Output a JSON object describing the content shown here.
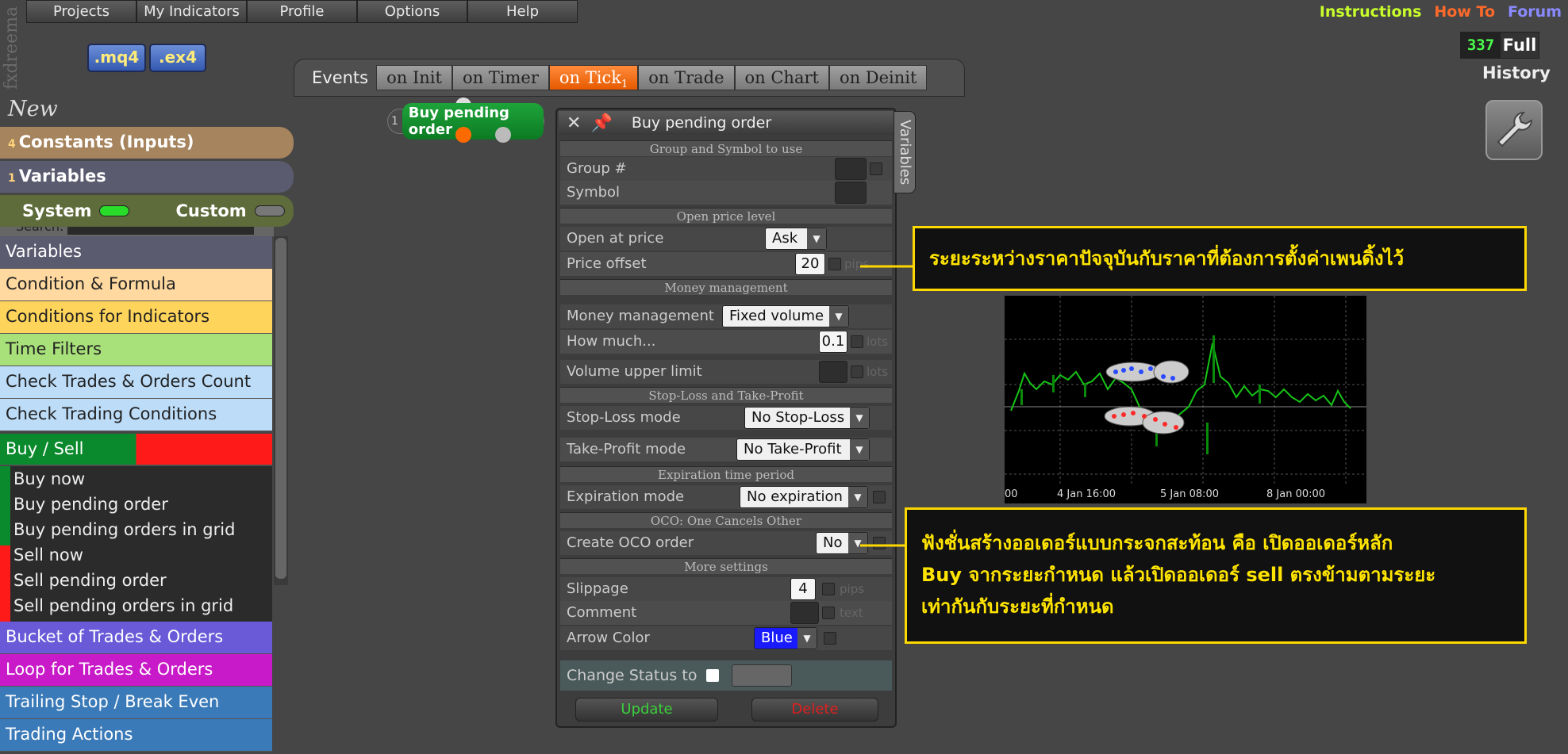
{
  "brand": "fxdreema",
  "menu": [
    "Projects",
    "My Indicators",
    "Profile",
    "Options",
    "Help"
  ],
  "files": {
    "mq4": ".mq4",
    "ex4": ".ex4"
  },
  "toplinks": {
    "instructions": "Instructions",
    "howto": "How To",
    "forum": "Forum"
  },
  "counter": {
    "value": "337",
    "label": "Full"
  },
  "history": "History",
  "events": {
    "label": "Events",
    "tabs": [
      "on Init",
      "on Timer",
      "on Tick",
      "on Trade",
      "on Chart",
      "on Deinit"
    ],
    "active": "on Tick",
    "active_count": "1"
  },
  "sidebar": {
    "new_label": "New",
    "constants": {
      "count": "4",
      "label": "Constants (Inputs)"
    },
    "variables": {
      "count": "1",
      "label": "Variables"
    },
    "system": "System",
    "custom": "Custom",
    "search": "Search:",
    "categories": [
      "Variables",
      "Condition & Formula",
      "Conditions for Indicators",
      "Time Filters",
      "Check Trades & Orders Count",
      "Check Trading Conditions",
      "Buy / Sell"
    ],
    "buy_items": [
      "Buy now",
      "Buy pending order",
      "Buy pending orders in grid"
    ],
    "sell_items": [
      "Sell now",
      "Sell pending order",
      "Sell pending orders in grid"
    ],
    "more": [
      "Bucket of Trades & Orders",
      "Loop for Trades & Orders",
      "Trailing Stop / Break Even",
      "Trading Actions"
    ]
  },
  "node": {
    "num": "1",
    "label": "Buy pending order"
  },
  "dialog": {
    "title": "Buy pending order",
    "vartab": "Variables",
    "sec_group": "Group and Symbol to use",
    "group": "Group #",
    "symbol": "Symbol",
    "sec_open": "Open price level",
    "open_at": "Open at price",
    "open_at_val": "Ask",
    "offset": "Price offset",
    "offset_val": "20",
    "offset_unit": "pips",
    "sec_money": "Money management",
    "mm": "Money management",
    "mm_val": "Fixed volume",
    "howmuch": "How much...",
    "howmuch_val": "0.1",
    "lots": "lots",
    "vol_upper": "Volume upper limit",
    "sec_sl": "Stop-Loss and Take-Profit",
    "sl": "Stop-Loss mode",
    "sl_val": "No Stop-Loss",
    "tp": "Take-Profit mode",
    "tp_val": "No Take-Profit",
    "sec_exp": "Expiration time period",
    "exp": "Expiration mode",
    "exp_val": "No expiration",
    "sec_oco": "OCO: One Cancels Other",
    "oco": "Create OCO order",
    "oco_val": "No",
    "sec_more": "More settings",
    "slippage": "Slippage",
    "slippage_val": "4",
    "pips": "pips",
    "comment": "Comment",
    "text": "text",
    "arrow": "Arrow Color",
    "arrow_val": "Blue",
    "status": "Change Status to",
    "update": "Update",
    "delete": "Delete"
  },
  "callout1": "ระยะระหว่างราคาปัจจุบันกับราคาที่ต้องการตั้งค่าเพนดิ้งไว้",
  "callout2": [
    "ฟังชั่นสร้างออเดอร์แบบกระจกสะท้อน คือ เปิดออเดอร์หลัก",
    "Buy จากระยะกำหนด แล้วเปิดออเดอร์ sell ตรงข้ามตามระยะ",
    "เท่ากันกับระยะที่กำหนด"
  ],
  "chart_axis": [
    "00",
    "4 Jan 16:00",
    "5 Jan 08:00",
    "8 Jan 00:00"
  ],
  "colors": {
    "accent": "#e65a00",
    "buy": "#0a8a2c",
    "sell": "#ff1a1a",
    "callout": "#ffd800"
  }
}
